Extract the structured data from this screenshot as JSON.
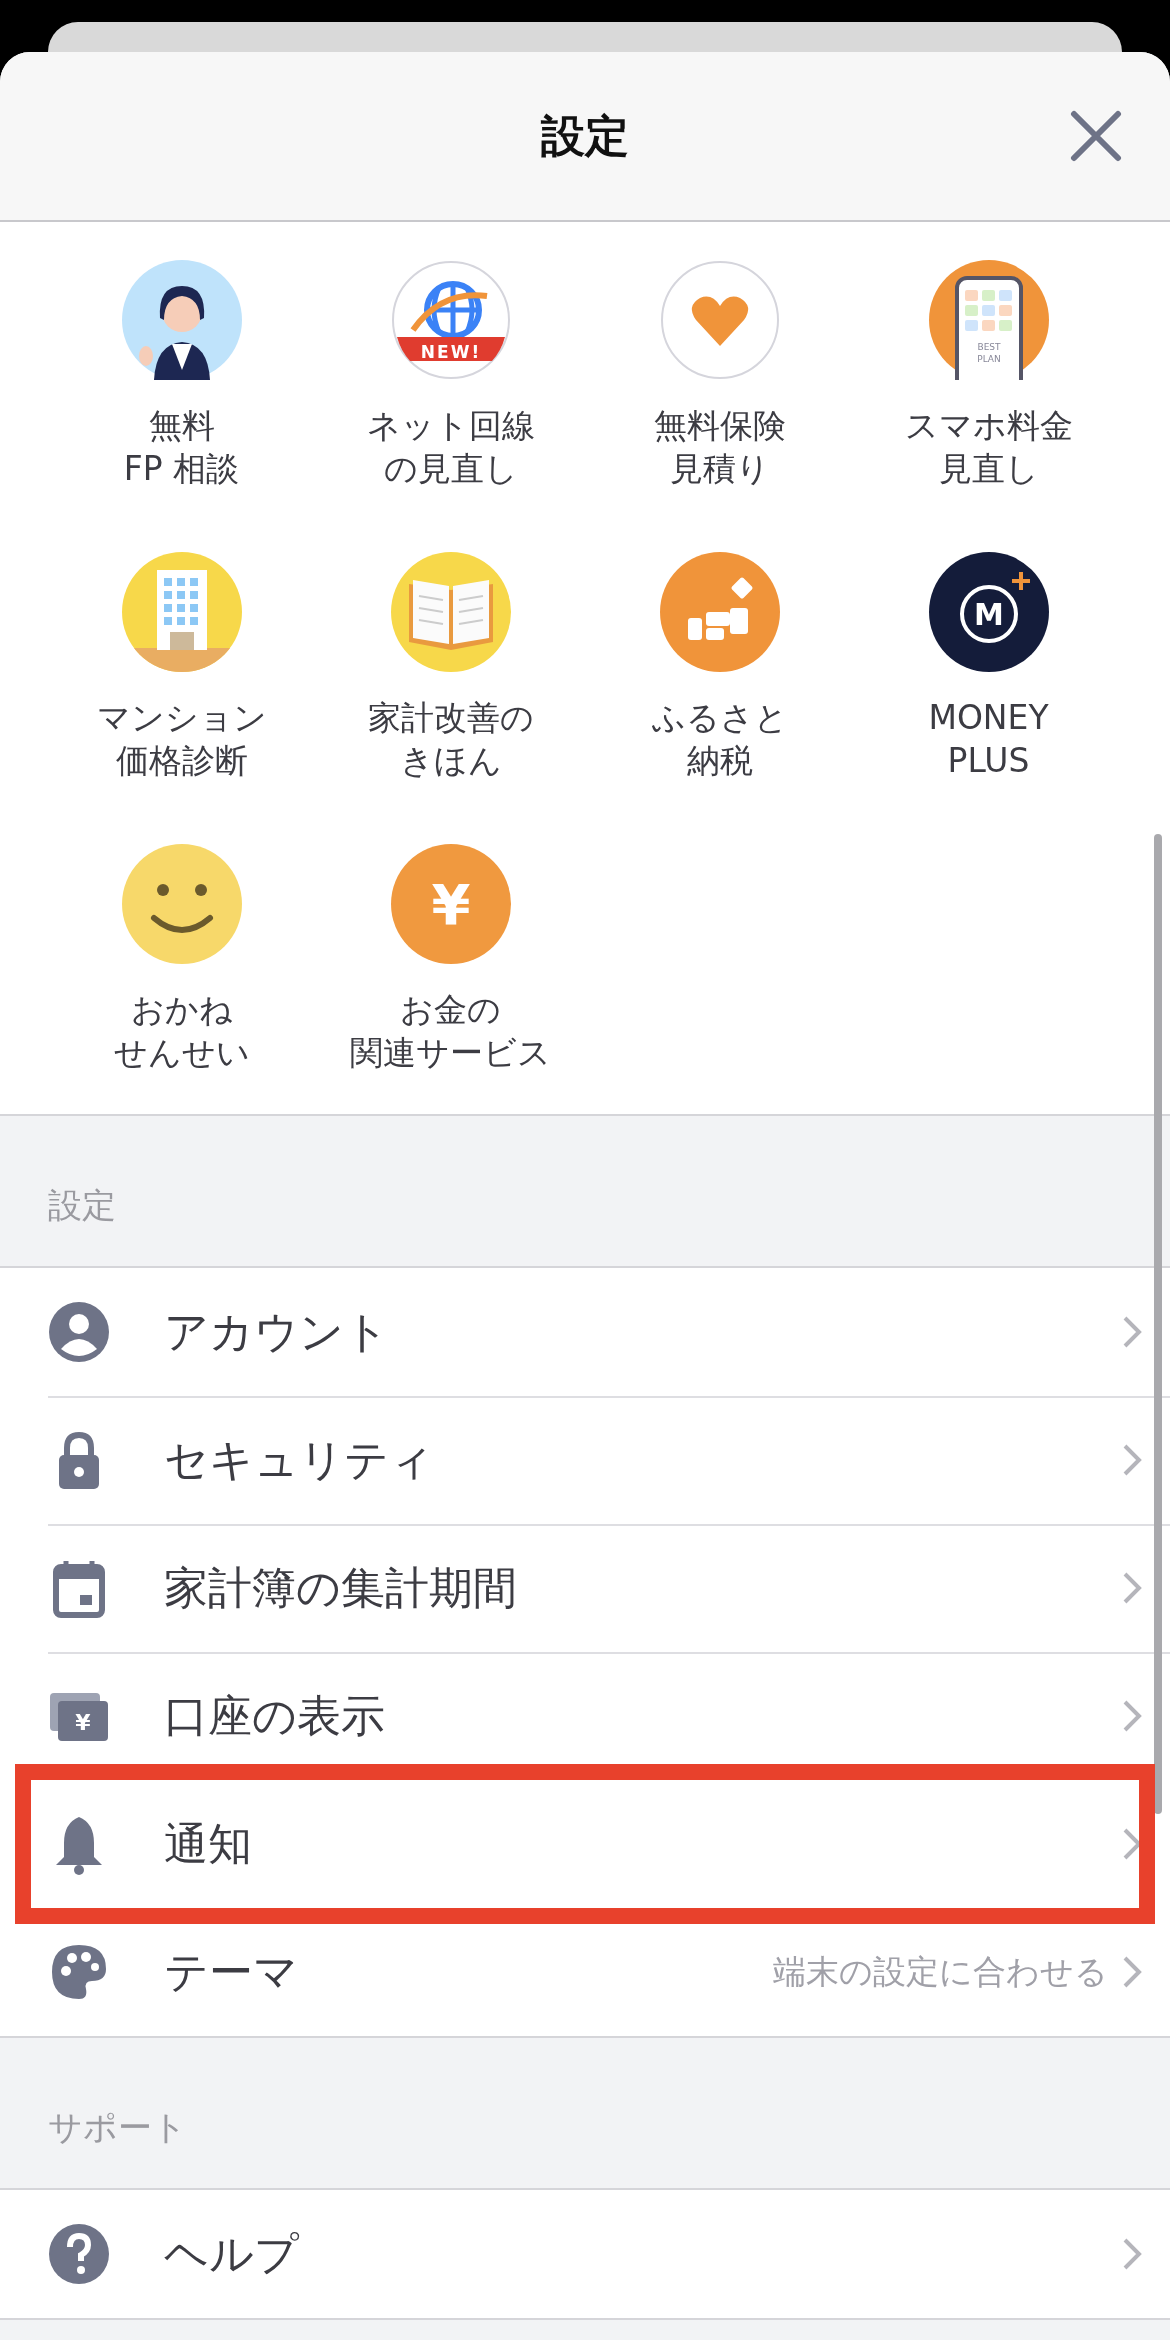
{
  "header": {
    "title": "設定"
  },
  "services": [
    {
      "lines": [
        "無料",
        "FP 相談"
      ]
    },
    {
      "lines": [
        "ネット回線",
        "の見直し"
      ],
      "badge": "NEW!"
    },
    {
      "lines": [
        "無料保険",
        "見積り"
      ]
    },
    {
      "lines": [
        "スマホ料金",
        "見直し"
      ],
      "badge": "BEST PLAN"
    },
    {
      "lines": [
        "マンション",
        "価格診断"
      ]
    },
    {
      "lines": [
        "家計改善の",
        "きほん"
      ]
    },
    {
      "lines": [
        "ふるさと",
        "納税"
      ]
    },
    {
      "lines": [
        "MONEY",
        "PLUS"
      ],
      "glyph": "M"
    },
    {
      "lines": [
        "おかね",
        "せんせい"
      ]
    },
    {
      "lines": [
        "お金の",
        "関連サービス"
      ],
      "glyph": "¥"
    }
  ],
  "sections": [
    {
      "title": "設定",
      "items": [
        {
          "label": "アカウント",
          "highlighted": false
        },
        {
          "label": "セキュリティ",
          "highlighted": false
        },
        {
          "label": "家計簿の集計期間",
          "highlighted": false
        },
        {
          "label": "口座の表示",
          "glyph": "¥",
          "highlighted": false
        },
        {
          "label": "通知",
          "highlighted": true
        },
        {
          "label": "テーマ",
          "value": "端末の設定に合わせる",
          "highlighted": false
        }
      ]
    },
    {
      "title": "サポート",
      "items": [
        {
          "label": "ヘルプ",
          "highlighted": false
        }
      ]
    }
  ]
}
